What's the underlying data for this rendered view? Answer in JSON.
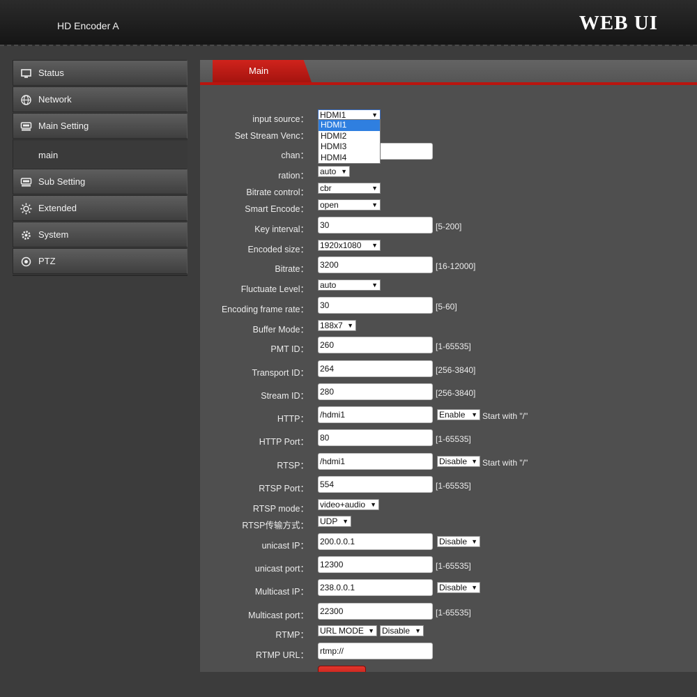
{
  "header": {
    "title": "HD Encoder  A",
    "brand": "WEB  UI"
  },
  "sidebar": {
    "items": [
      {
        "label": "Status",
        "icon": "monitor-icon"
      },
      {
        "label": "Network",
        "icon": "globe-icon"
      },
      {
        "label": "Main Setting",
        "icon": "encoder-icon"
      },
      {
        "label": "main",
        "sub": true
      },
      {
        "label": "Sub Setting",
        "icon": "encoder-icon"
      },
      {
        "label": "Extended",
        "icon": "sun-gear-icon"
      },
      {
        "label": "System",
        "icon": "gear-icon"
      },
      {
        "label": "PTZ",
        "icon": "target-icon"
      }
    ]
  },
  "tabs": [
    {
      "label": "Main"
    }
  ],
  "dropdown": {
    "options": [
      "HDMI1",
      "HDMI2",
      "HDMI3",
      "HDMI4"
    ],
    "active": 0
  },
  "form": {
    "input_source": {
      "label": "input source：",
      "value": "HDMI1"
    },
    "stream_venc": {
      "label": "Set Stream Venc："
    },
    "chan": {
      "label": "chan："
    },
    "ration": {
      "label": "ration：",
      "value": "auto"
    },
    "bitrate_control": {
      "label": "Bitrate control：",
      "value": "cbr"
    },
    "smart_encode": {
      "label": "Smart Encode：",
      "value": "open"
    },
    "key_interval": {
      "label": "Key interval：",
      "value": "30",
      "range": "[5-200]"
    },
    "encoded_size": {
      "label": "Encoded size：",
      "value": "1920x1080"
    },
    "bitrate": {
      "label": "Bitrate：",
      "value": "3200",
      "range": "[16-12000]"
    },
    "fluctuate": {
      "label": "Fluctuate Level：",
      "value": "auto"
    },
    "frame_rate": {
      "label": "Encoding frame rate：",
      "value": "30",
      "range": "[5-60]"
    },
    "buffer_mode": {
      "label": "Buffer Mode：",
      "value": "188x7"
    },
    "pmt_id": {
      "label": "PMT ID：",
      "value": "260",
      "range": "[1-65535]"
    },
    "transport_id": {
      "label": "Transport ID：",
      "value": "264",
      "range": "[256-3840]"
    },
    "stream_id": {
      "label": "Stream ID：",
      "value": "280",
      "range": "[256-3840]"
    },
    "http": {
      "label": "HTTP：",
      "value": "/hdmi1",
      "select": "Enable",
      "hint": "Start with \"/\""
    },
    "http_port": {
      "label": "HTTP Port：",
      "value": "80",
      "range": "[1-65535]"
    },
    "rtsp": {
      "label": "RTSP：",
      "value": "/hdmi1",
      "select": "Disable",
      "hint": "Start with \"/\""
    },
    "rtsp_port": {
      "label": "RTSP Port：",
      "value": "554",
      "range": "[1-65535]"
    },
    "rtsp_mode": {
      "label": "RTSP mode：",
      "value": "video+audio"
    },
    "rtsp_transport": {
      "label": "RTSP传输方式：",
      "value": "UDP"
    },
    "unicast_ip": {
      "label": "unicast IP：",
      "value": "200.0.0.1",
      "select": "Disable"
    },
    "unicast_port": {
      "label": "unicast port：",
      "value": "12300",
      "range": "[1-65535]"
    },
    "multicast_ip": {
      "label": "Multicast IP：",
      "value": "238.0.0.1",
      "select": "Disable"
    },
    "multicast_port": {
      "label": "Multicast port：",
      "value": "22300",
      "range": "[1-65535]"
    },
    "rtmp": {
      "label": "RTMP：",
      "mode": "URL MODE",
      "select": "Disable"
    },
    "rtmp_url": {
      "label": "RTMP URL：",
      "value": "rtmp://"
    }
  },
  "colors": {
    "accent": "#c41a14",
    "panel": "#4f4f4f",
    "background": "#3c3c3c"
  }
}
